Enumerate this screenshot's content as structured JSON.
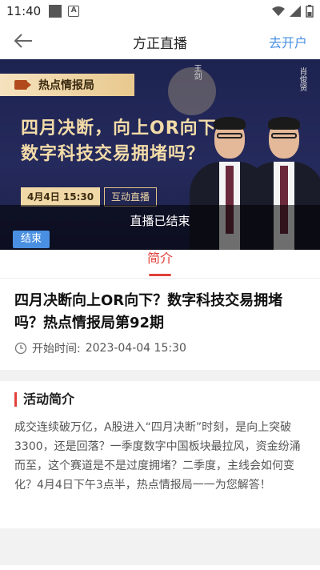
{
  "status_bar": {
    "time": "11:40"
  },
  "nav": {
    "title": "方正直播",
    "action": "去开户"
  },
  "banner": {
    "tag": "热点情报局",
    "headline_line1": "四月决断，向上OR向下？",
    "headline_line2": "数字科技交易拥堵吗？",
    "date": "4月4日 15:30",
    "mode": "互动直播",
    "speaker_left": "王剑",
    "speaker_right": "肖俊贤",
    "status": "直播已结束",
    "badge": "结束"
  },
  "tabs": {
    "intro": "简介"
  },
  "live": {
    "title": "四月决断向上OR向下？数字科技交易拥堵吗？热点情报局第92期",
    "start_label": "开始时间:",
    "start_time": "2023-04-04 15:30"
  },
  "activity": {
    "title": "活动简介",
    "body": "成交连续破万亿，A股进入“四月决断”时刻，是向上突破3300，还是回落？一季度数字中国板块最拉风，资金纷涌而至，这个赛道是不是过度拥堵？二季度，主线会如何变化？4月4日下午3点半，热点情报局一一为您解答！"
  },
  "colors": {
    "accent": "#e0413a",
    "link": "#4a90e2",
    "banner_bg": "#1d2350",
    "banner_gold": "#f3dba8"
  },
  "icons": [
    "back-arrow-icon",
    "clock-icon",
    "video-icon",
    "wifi-icon",
    "signal-icon",
    "battery-icon"
  ]
}
